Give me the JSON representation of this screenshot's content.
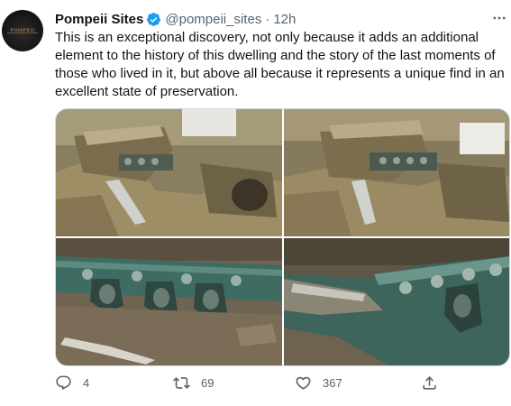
{
  "tweet": {
    "author": {
      "name": "Pompeii Sites",
      "handle": "@pompeii_sites",
      "verified": true,
      "avatar_icon": "pompeii-logo",
      "avatar_logo_text": "POMPEII"
    },
    "separator": "·",
    "time": "12h",
    "text": "This is an exceptional discovery, not only because it adds an additional element to the history of this dwelling and the story of the last moments of those who lived in it, but above all because it represents a unique find in an excellent state of preservation.",
    "media": [
      {
        "icon": "photo-chariot-top-left"
      },
      {
        "icon": "photo-chariot-top-right"
      },
      {
        "icon": "photo-chariot-decoration-closeup"
      },
      {
        "icon": "photo-chariot-side-closeup"
      }
    ],
    "actions": {
      "reply": {
        "icon": "reply-icon",
        "count": "4"
      },
      "retweet": {
        "icon": "retweet-icon",
        "count": "69"
      },
      "like": {
        "icon": "heart-icon",
        "count": "367"
      },
      "share": {
        "icon": "share-icon"
      }
    },
    "colors": {
      "text": "#0f1419",
      "secondary": "#536471",
      "verified": "#1d9bf0",
      "border": "#cfd9de"
    }
  }
}
